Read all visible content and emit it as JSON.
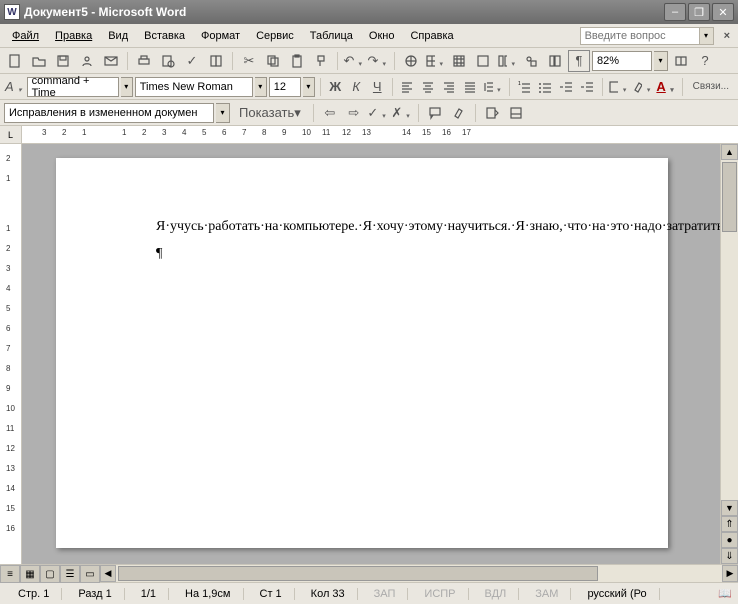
{
  "titlebar": {
    "title": "Документ5 - Microsoft Word"
  },
  "menu": {
    "file": "Файл",
    "edit": "Правка",
    "view": "Вид",
    "insert": "Вставка",
    "format": "Формат",
    "tools": "Сервис",
    "table": "Таблица",
    "window": "Окно",
    "help": "Справка",
    "help_placeholder": "Введите вопрос"
  },
  "format_bar": {
    "style": "command + Time",
    "font": "Times New Roman",
    "size": "12",
    "link_panel": "Связи..."
  },
  "std_bar": {
    "zoom": "82%"
  },
  "review_bar": {
    "view_mode": "Исправления в измененном докумен",
    "show": "Показать"
  },
  "ruler": {
    "tab_mode": "L"
  },
  "document": {
    "body": "Я·учусь·работать·на·компьютере.·Я·хочу·этому·научиться.·Я·знаю,·что·на·это·надо·затратить·время·и·усилия,·но,·думаю,·что·это·окупится·в·скором·времени.·Я·надеюсь·подружиться·с·моим·компьютером.¶",
    "empty_para": "¶"
  },
  "status": {
    "page": "Стр. 1",
    "section": "Разд 1",
    "pages": "1/1",
    "at": "На 1,9см",
    "line": "Ст 1",
    "col": "Кол 33",
    "rec": "ЗАП",
    "trk": "ИСПР",
    "ext": "ВДЛ",
    "ovr": "ЗАМ",
    "lang": "русский (Ро"
  }
}
